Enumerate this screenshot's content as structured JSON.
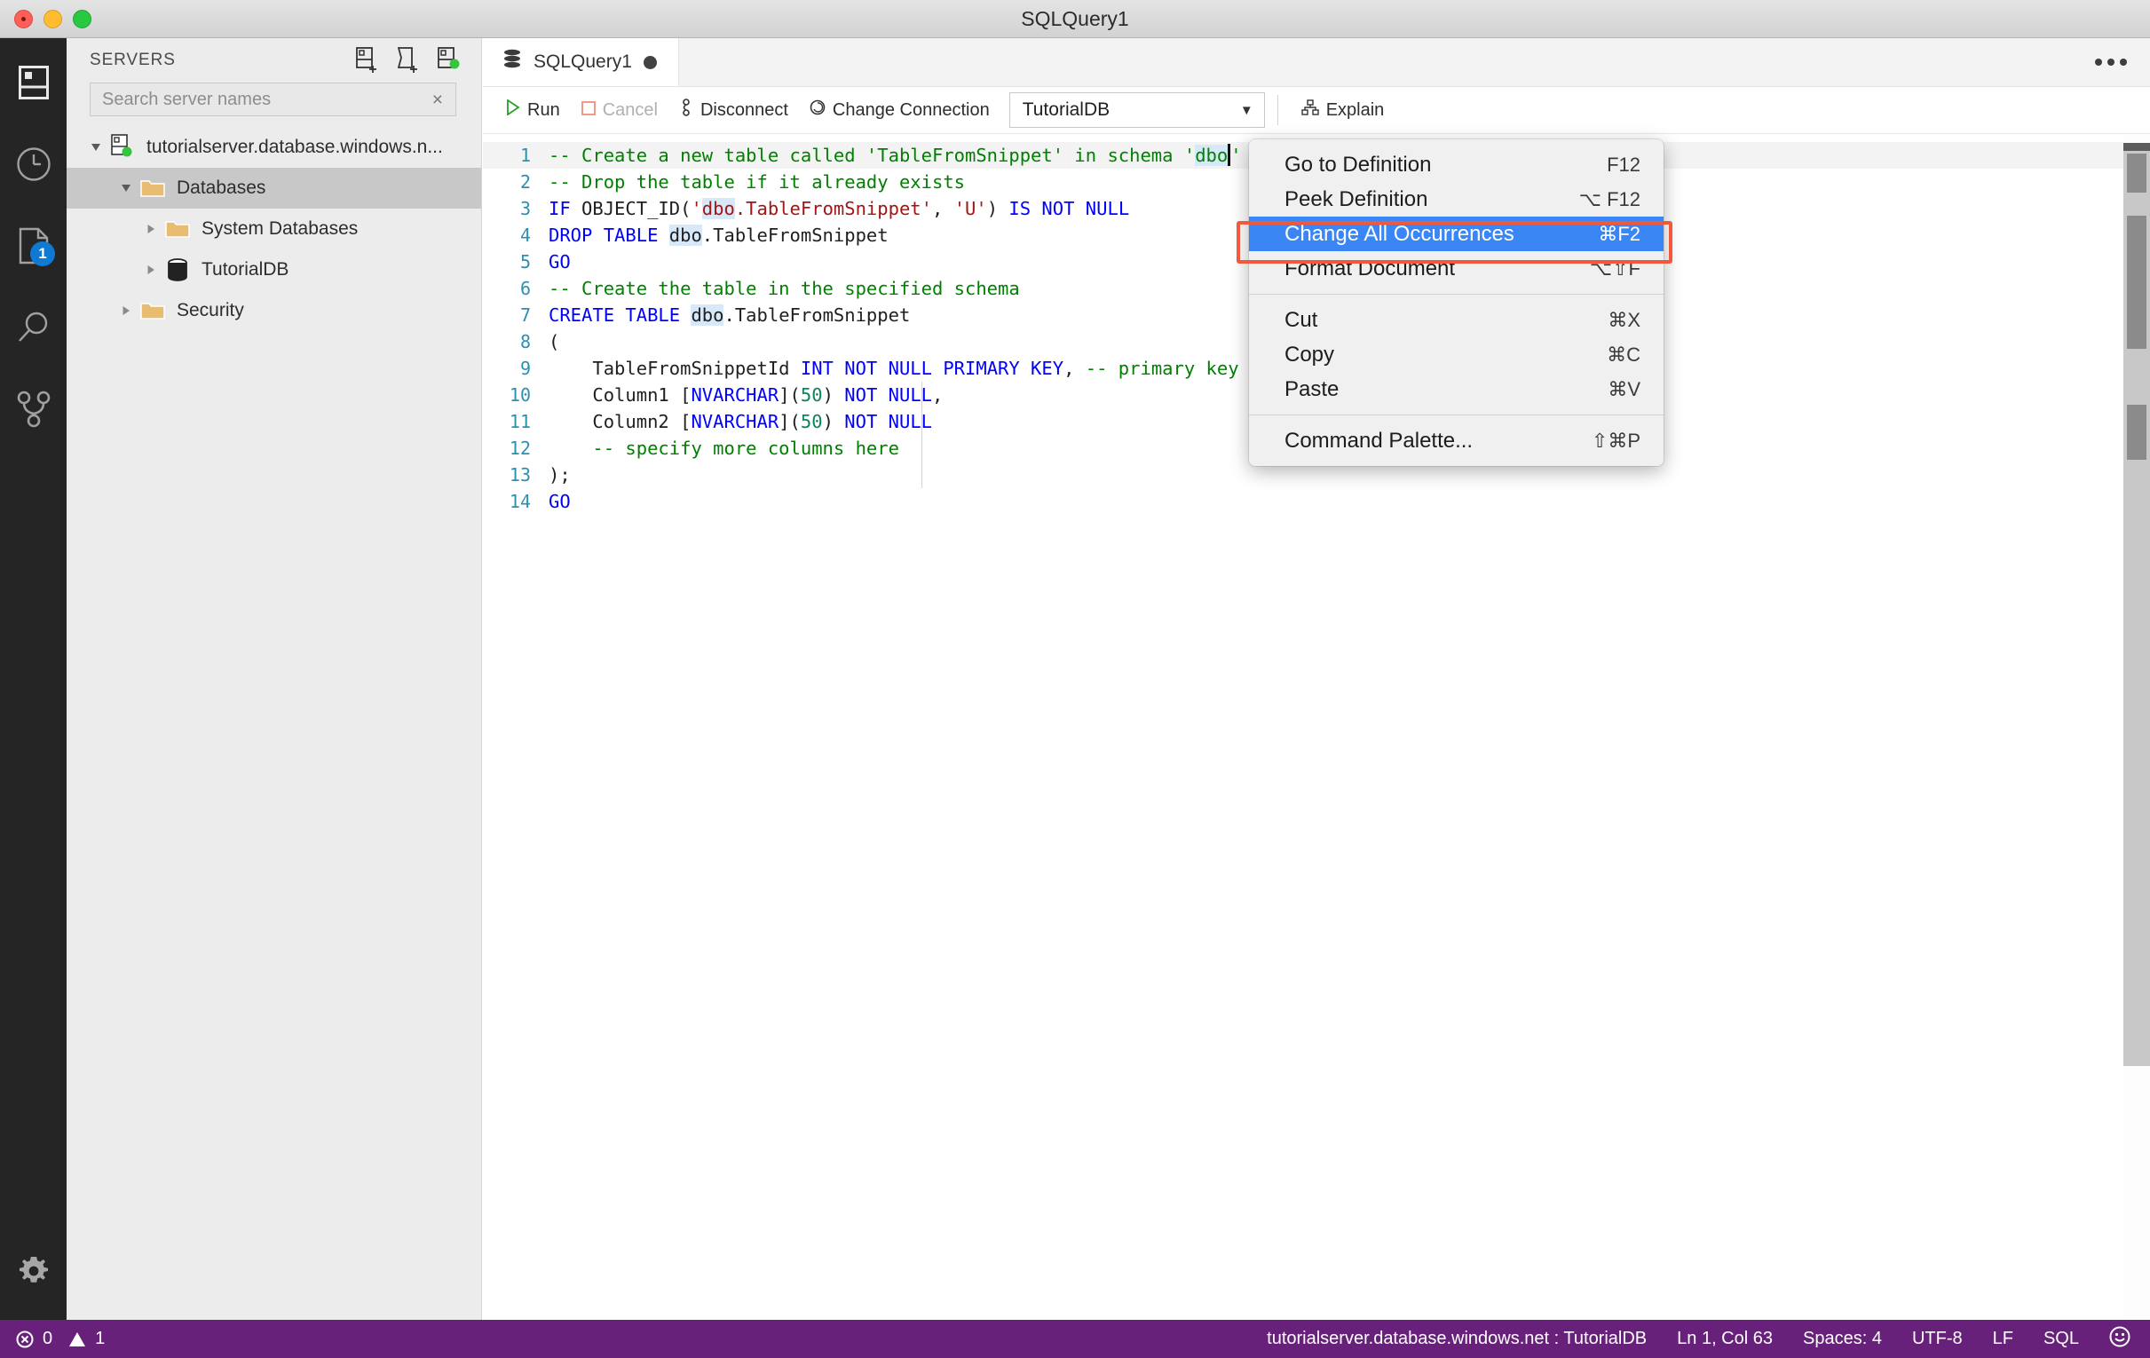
{
  "window": {
    "title": "SQLQuery1"
  },
  "activity_bar": {
    "items": [
      {
        "icon": "servers-icon",
        "name": "servers"
      },
      {
        "icon": "history-clock-icon",
        "name": "history"
      },
      {
        "icon": "query-file-icon",
        "name": "queries",
        "badge": "1"
      },
      {
        "icon": "search-icon",
        "name": "search"
      },
      {
        "icon": "source-control-icon",
        "name": "source-control"
      }
    ],
    "bottom": {
      "icon": "gear-icon",
      "name": "manage"
    }
  },
  "sidebar": {
    "title": "SERVERS",
    "actions": [
      {
        "name": "new-connection",
        "icon": "add-connection-icon"
      },
      {
        "name": "new-server-group",
        "icon": "add-server-group-icon"
      },
      {
        "name": "show-active-connections",
        "icon": "active-connections-icon"
      }
    ],
    "search": {
      "placeholder": "Search server names",
      "value": "",
      "clear": "×"
    },
    "tree": [
      {
        "label": "tutorialserver.database.windows.n...",
        "icon": "server-icon",
        "indent": 0,
        "twisty": "expanded",
        "selected": false
      },
      {
        "label": "Databases",
        "icon": "folder-icon",
        "indent": 1,
        "twisty": "expanded",
        "selected": true
      },
      {
        "label": "System Databases",
        "icon": "folder-icon",
        "indent": 2,
        "twisty": "collapsed",
        "selected": false
      },
      {
        "label": "TutorialDB",
        "icon": "database-icon",
        "indent": 2,
        "twisty": "collapsed",
        "selected": false
      },
      {
        "label": "Security",
        "icon": "folder-icon",
        "indent": 1,
        "twisty": "collapsed",
        "selected": false
      }
    ]
  },
  "editor": {
    "tab": {
      "label": "SQLQuery1",
      "icon": "database-icon",
      "dirty": true
    },
    "overflow_label": "...",
    "toolbar": {
      "run": "Run",
      "cancel": "Cancel",
      "disconnect": "Disconnect",
      "change_connection": "Change Connection",
      "database": "TutorialDB",
      "explain": "Explain"
    },
    "lines": [
      {
        "n": "1",
        "active": true,
        "tokens": [
          {
            "t": "-- Create a new table called 'TableFromSnippet' in schema '",
            "c": "cm"
          },
          {
            "t": "dbo",
            "c": "cm occ"
          },
          {
            "t": "",
            "c": "caret"
          },
          {
            "t": "'",
            "c": "cm"
          }
        ]
      },
      {
        "n": "2",
        "active": false,
        "tokens": [
          {
            "t": "-- Drop the table if it already exists",
            "c": "cm"
          }
        ]
      },
      {
        "n": "3",
        "active": false,
        "tokens": [
          {
            "t": "IF",
            "c": "kw"
          },
          {
            "t": " OBJECT_ID(",
            "c": "pl"
          },
          {
            "t": "'",
            "c": "str"
          },
          {
            "t": "dbo",
            "c": "str occ"
          },
          {
            "t": ".TableFromSnippet'",
            "c": "str"
          },
          {
            "t": ", ",
            "c": "pl"
          },
          {
            "t": "'U'",
            "c": "str"
          },
          {
            "t": ") ",
            "c": "pl"
          },
          {
            "t": "IS NOT NULL",
            "c": "kw"
          }
        ]
      },
      {
        "n": "4",
        "active": false,
        "tokens": [
          {
            "t": "DROP TABLE",
            "c": "kw"
          },
          {
            "t": " ",
            "c": "pl"
          },
          {
            "t": "dbo",
            "c": "pl occ"
          },
          {
            "t": ".TableFromSnippet",
            "c": "pl"
          }
        ]
      },
      {
        "n": "5",
        "active": false,
        "tokens": [
          {
            "t": "GO",
            "c": "kw"
          }
        ]
      },
      {
        "n": "6",
        "active": false,
        "tokens": [
          {
            "t": "-- Create the table in the specified schema",
            "c": "cm"
          }
        ]
      },
      {
        "n": "7",
        "active": false,
        "tokens": [
          {
            "t": "CREATE TABLE",
            "c": "kw"
          },
          {
            "t": " ",
            "c": "pl"
          },
          {
            "t": "dbo",
            "c": "pl occ"
          },
          {
            "t": ".TableFromSnippet",
            "c": "pl"
          }
        ]
      },
      {
        "n": "8",
        "active": false,
        "tokens": [
          {
            "t": "(",
            "c": "pl"
          }
        ]
      },
      {
        "n": "9",
        "active": false,
        "tokens": [
          {
            "t": "    TableFromSnippetId ",
            "c": "pl"
          },
          {
            "t": "INT NOT NULL PRIMARY KEY",
            "c": "kw"
          },
          {
            "t": ", ",
            "c": "pl"
          },
          {
            "t": "-- primary key",
            "c": "cm"
          }
        ]
      },
      {
        "n": "10",
        "active": false,
        "tokens": [
          {
            "t": "    Column1 [",
            "c": "pl"
          },
          {
            "t": "NVARCHAR",
            "c": "kw"
          },
          {
            "t": "](",
            "c": "pl"
          },
          {
            "t": "50",
            "c": "num"
          },
          {
            "t": ") ",
            "c": "pl"
          },
          {
            "t": "NOT NULL",
            "c": "kw"
          },
          {
            "t": ",",
            "c": "pl"
          }
        ]
      },
      {
        "n": "11",
        "active": false,
        "tokens": [
          {
            "t": "    Column2 [",
            "c": "pl"
          },
          {
            "t": "NVARCHAR",
            "c": "kw"
          },
          {
            "t": "](",
            "c": "pl"
          },
          {
            "t": "50",
            "c": "num"
          },
          {
            "t": ") ",
            "c": "pl"
          },
          {
            "t": "NOT NULL",
            "c": "kw"
          }
        ]
      },
      {
        "n": "12",
        "active": false,
        "tokens": [
          {
            "t": "    -- specify more columns here",
            "c": "cm"
          }
        ]
      },
      {
        "n": "13",
        "active": false,
        "tokens": [
          {
            "t": ");",
            "c": "pl"
          }
        ]
      },
      {
        "n": "14",
        "active": false,
        "tokens": [
          {
            "t": "GO",
            "c": "kw"
          }
        ]
      }
    ]
  },
  "context_menu": {
    "groups": [
      [
        {
          "label": "Go to Definition",
          "key": "F12",
          "highlight": false
        },
        {
          "label": "Peek Definition",
          "key": "⌥ F12",
          "highlight": false
        },
        {
          "label": "Change All Occurrences",
          "key": "⌘F2",
          "highlight": true
        },
        {
          "label": "Format Document",
          "key": "⌥⇧F",
          "highlight": false
        }
      ],
      [
        {
          "label": "Cut",
          "key": "⌘X",
          "highlight": false
        },
        {
          "label": "Copy",
          "key": "⌘C",
          "highlight": false
        },
        {
          "label": "Paste",
          "key": "⌘V",
          "highlight": false
        }
      ],
      [
        {
          "label": "Command Palette...",
          "key": "⇧⌘P",
          "highlight": false
        }
      ]
    ],
    "highlight_color": "#3b86f5",
    "annotation_box_color": "#f1583c"
  },
  "status_bar": {
    "background": "#68217a",
    "errors": "0",
    "warnings": "1",
    "connection": "tutorialserver.database.windows.net : TutorialDB",
    "position": "Ln 1, Col 63",
    "spaces": "Spaces: 4",
    "encoding": "UTF-8",
    "eol": "LF",
    "language": "SQL",
    "feedback_icon": "smiley-icon"
  }
}
